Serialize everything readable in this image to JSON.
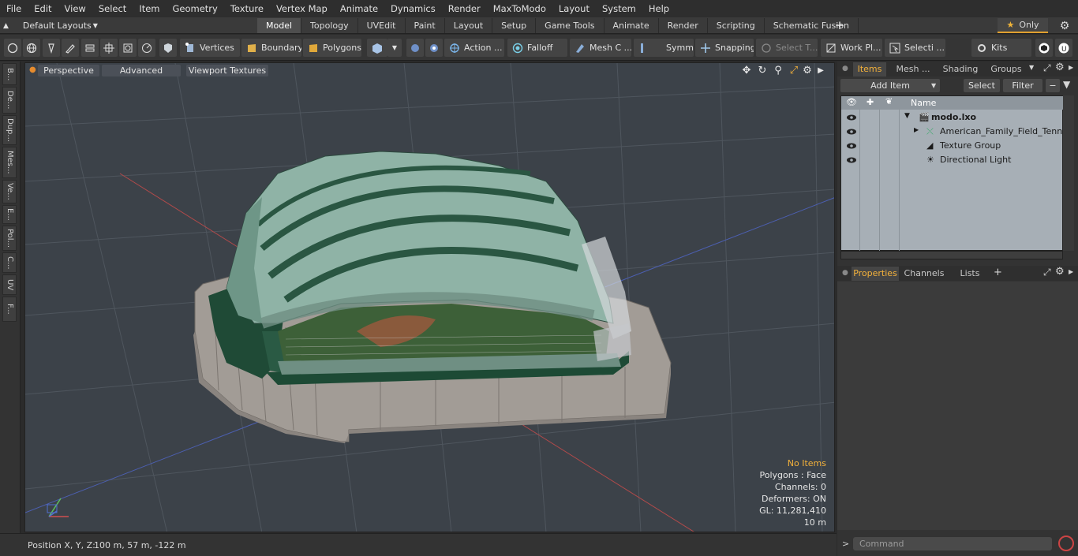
{
  "menu": [
    "File",
    "Edit",
    "View",
    "Select",
    "Item",
    "Geometry",
    "Texture",
    "Vertex Map",
    "Animate",
    "Dynamics",
    "Render",
    "MaxToModo",
    "Layout",
    "System",
    "Help"
  ],
  "layout_select": "Default Layouts",
  "tabs": [
    "Model",
    "Topology",
    "UVEdit",
    "Paint",
    "Layout",
    "Setup",
    "Game Tools",
    "Animate",
    "Render",
    "Scripting",
    "Schematic Fusion"
  ],
  "active_tab": "Model",
  "only_label": "Only",
  "toolbar": {
    "vertices": "Vertices",
    "boundary": "Boundary",
    "polygons": "Polygons",
    "action": "Action ...",
    "falloff": "Falloff",
    "mesh": "Mesh C ...",
    "symm": "Symm ...",
    "snapping": "Snapping",
    "select_t": "Select T...",
    "workpl": "Work Pl...",
    "selecti": "Selecti ...",
    "kits": "Kits"
  },
  "left_tabs": [
    "B...",
    "De...",
    "Dup...",
    "Mes...",
    "Ve...",
    "E...",
    "Pol...",
    "C...",
    "UV",
    "F..."
  ],
  "viewport": {
    "perspective": "Perspective",
    "advanced": "Advanced",
    "textures": "Viewport Textures",
    "stats": {
      "no_items": "No Items",
      "polygons": "Polygons : Face",
      "channels": "Channels: 0",
      "deformers": "Deformers: ON",
      "gl": "GL: 11,281,410",
      "scale": "10 m"
    }
  },
  "status": {
    "label": "Position X, Y, Z:",
    "value": "100 m, 57 m, -122 m"
  },
  "right_panel": {
    "tabs": [
      "Items",
      "Mesh ...",
      "Shading",
      "Groups"
    ],
    "add_item": "Add Item",
    "select": "Select",
    "filter": "Filter",
    "name_header": "Name",
    "items": [
      {
        "name": "modo.lxo",
        "icon": "scene-icon"
      },
      {
        "name": "American_Family_Field_Tennis",
        "icon": "mesh-icon"
      },
      {
        "name": "Texture Group",
        "icon": "texture-group-icon"
      },
      {
        "name": "Directional Light",
        "icon": "light-icon"
      }
    ],
    "props_tabs": [
      "Properties",
      "Channels",
      "Lists"
    ],
    "command_placeholder": "Command"
  },
  "colors": {
    "accent": "#f3b13b",
    "viewport_bg": "#3c4249",
    "roof": "#8fb3a6",
    "concrete": "#a8a29c"
  }
}
